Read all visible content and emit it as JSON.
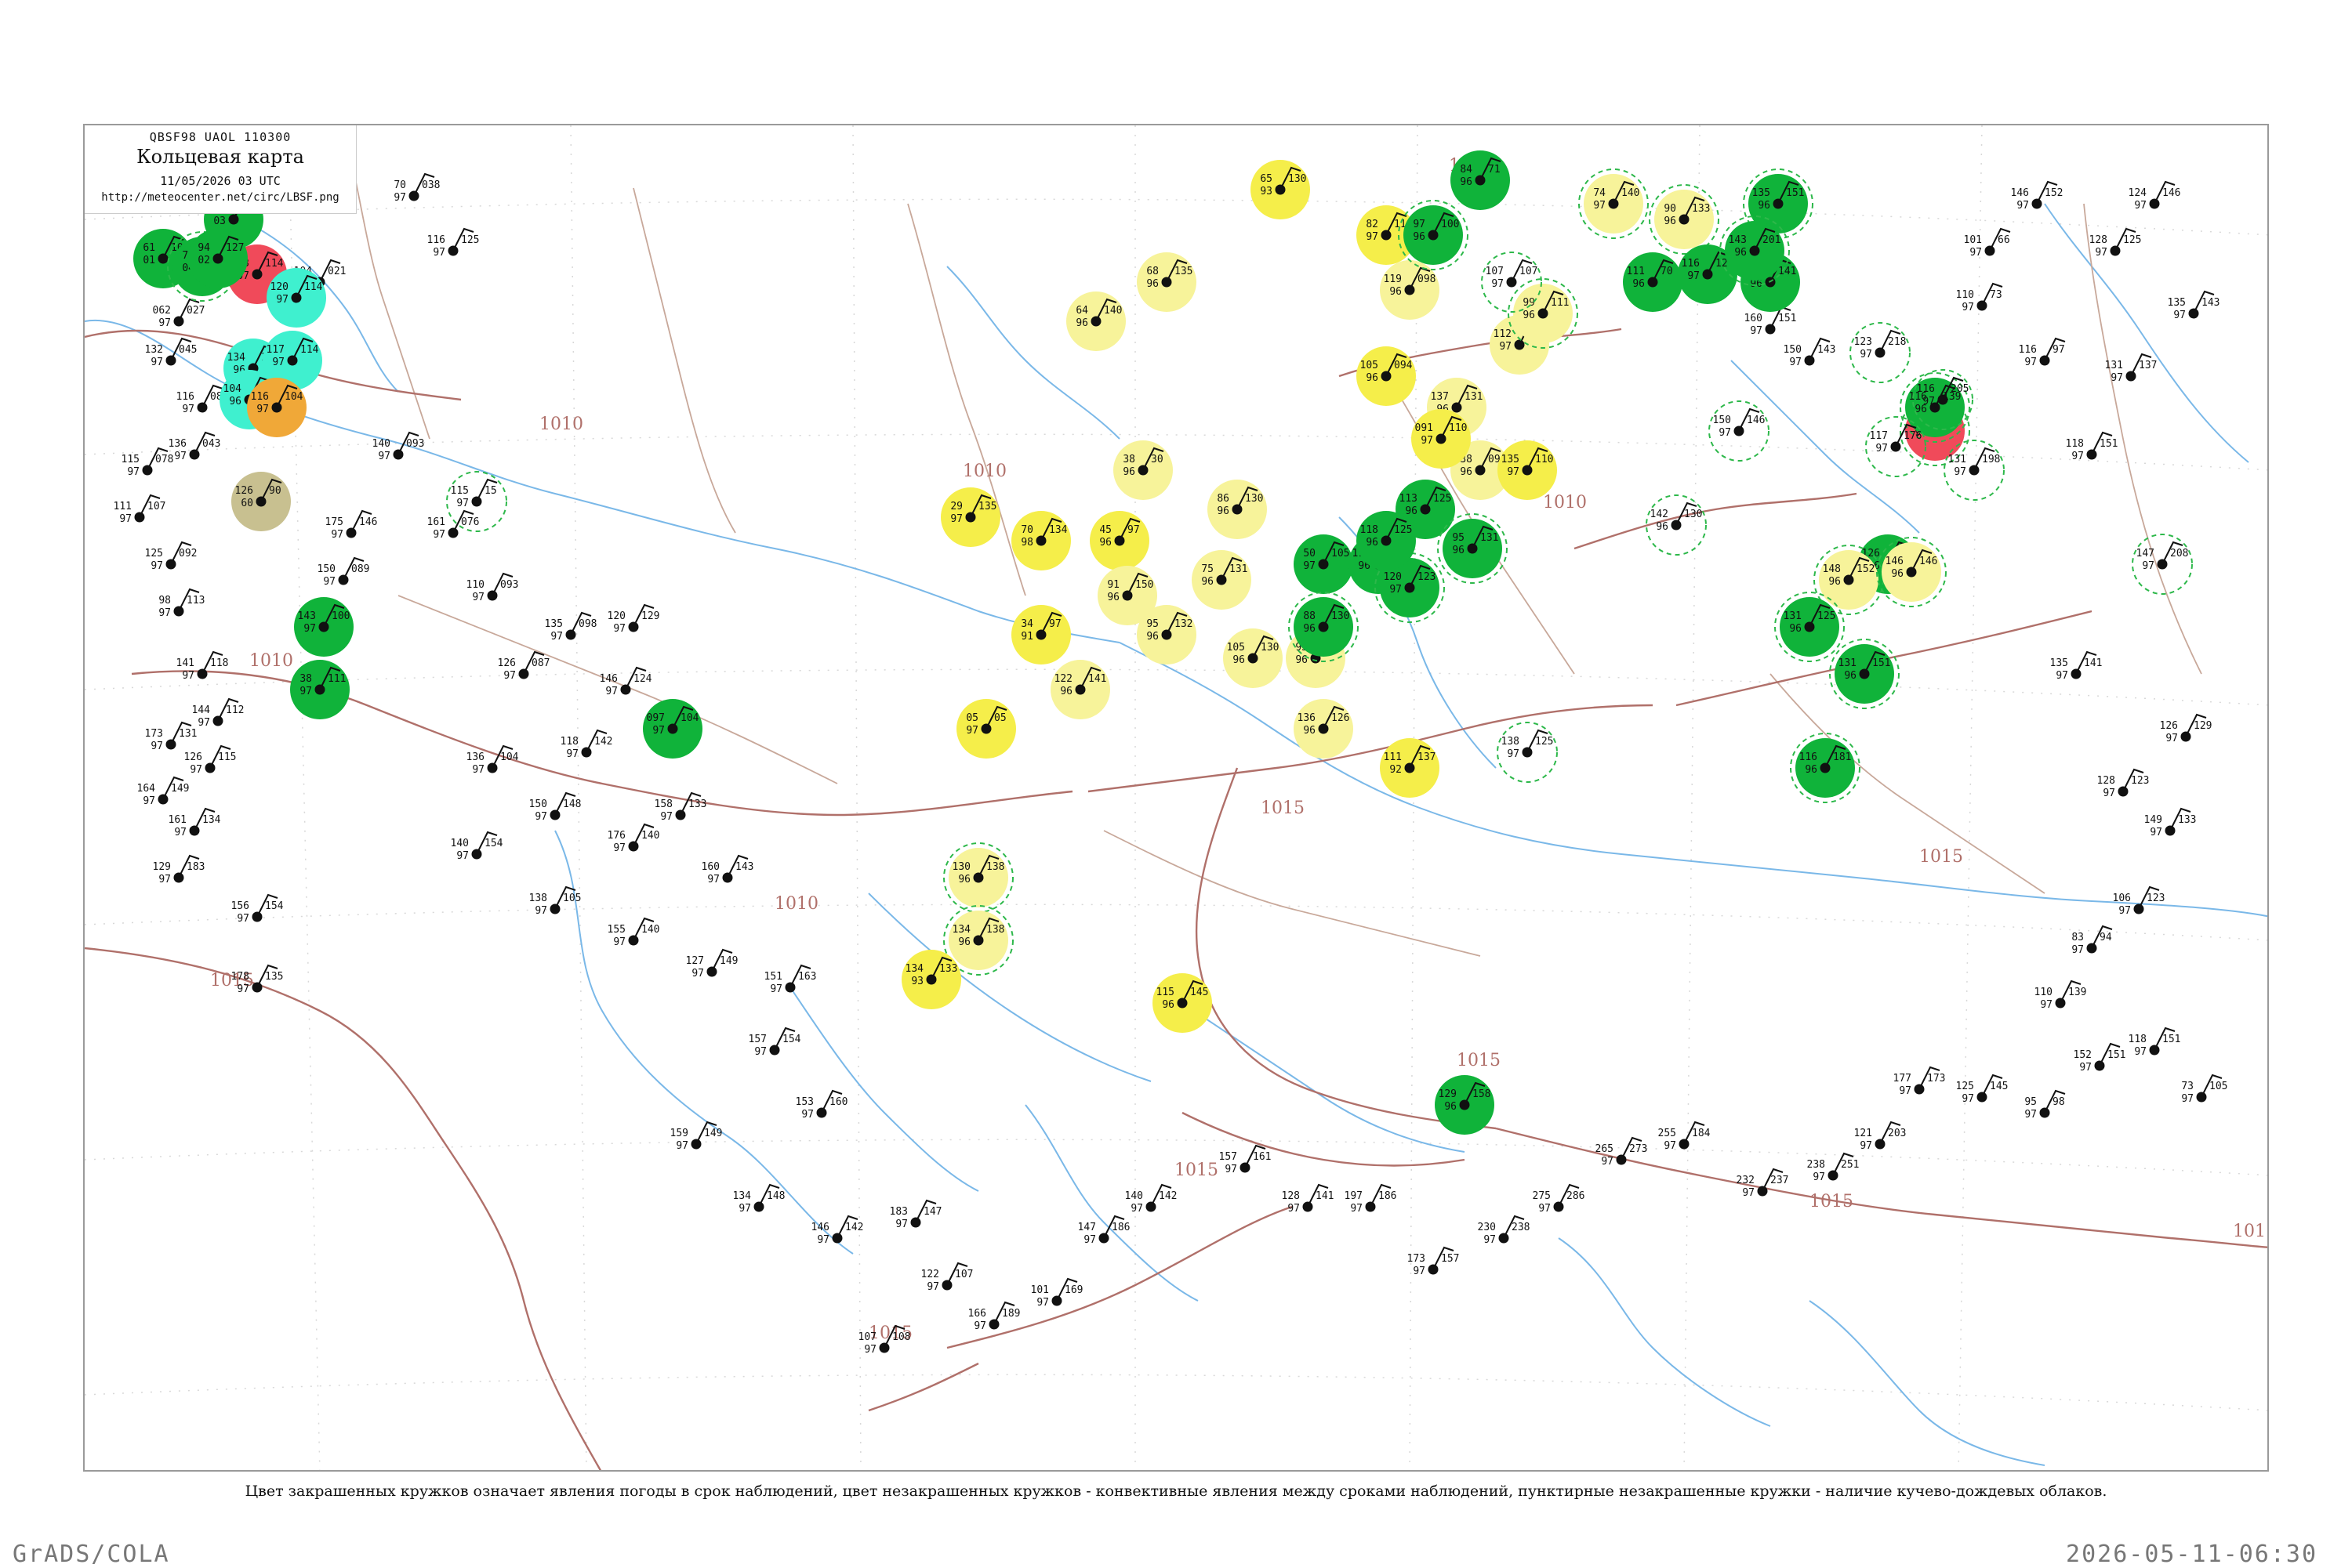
{
  "header": {
    "code": "QBSF98  UAOL  110300",
    "title": "Кольцевая карта",
    "time": "11/05/2026 03 UTC",
    "url": "http://meteocenter.net/circ/LBSF.png"
  },
  "legend": "Цвет закрашенных кружков означает явления погоды в срок наблюдений, цвет незакрашенных кружков - конвективные явления между сроками наблюдений, пунктирные незакрашенные кружки - наличие кучево-дождевых облаков.",
  "footer": {
    "left": "GrADS/COLA",
    "right": "2026-05-11-06:30"
  },
  "isobars": [
    {
      "label": "1005"
    },
    {
      "label": "1010"
    },
    {
      "label": "1015"
    },
    {
      "label": "1010"
    },
    {
      "label": "1015"
    },
    {
      "label": "1015"
    },
    {
      "label": "1010"
    },
    {
      "label": "1015"
    },
    {
      "label": "1015"
    },
    {
      "label": "101"
    },
    {
      "label": "1010"
    },
    {
      "label": "1015"
    },
    {
      "label": "1015"
    },
    {
      "label": "1010"
    },
    {
      "label": "1010"
    }
  ],
  "colors": {
    "green": "#10b33a",
    "yellow": "#f5ee4a",
    "light_yellow": "#f7f39a",
    "cyan": "#3ff0cf",
    "orange": "#f0a838",
    "red": "#f04a5a",
    "olive": "#c8c090",
    "isobar": "#b0706a",
    "coast": "#7ab8e8",
    "border": "#c8a89a"
  },
  "stations": [
    {
      "kind": "filled",
      "color": "green",
      "cb": false,
      "t": "61",
      "td": "01",
      "p": "107"
    },
    {
      "kind": "filled",
      "color": "green",
      "cb": true,
      "t": "71",
      "td": "04",
      "p": "103"
    },
    {
      "kind": "filled",
      "color": "green",
      "cb": false,
      "t": "79",
      "td": "03",
      "p": "121"
    },
    {
      "kind": "filled",
      "color": "red",
      "cb": false,
      "t": "153",
      "td": "07",
      "p": "114"
    },
    {
      "kind": "filled",
      "color": "green",
      "cb": false,
      "t": "94",
      "td": "02",
      "p": "127"
    },
    {
      "kind": "filled",
      "color": "cyan",
      "cb": false,
      "t": "120",
      "td": "97",
      "p": "114"
    },
    {
      "kind": "filled",
      "color": "cyan",
      "cb": false,
      "t": "134",
      "td": "96",
      "p": "100"
    },
    {
      "kind": "filled",
      "color": "cyan",
      "cb": false,
      "t": "117",
      "td": "97",
      "p": "114"
    },
    {
      "kind": "filled",
      "color": "cyan",
      "cb": false,
      "t": "104",
      "td": "96",
      "p": "114"
    },
    {
      "kind": "filled",
      "color": "orange",
      "cb": false,
      "t": "116",
      "td": "97",
      "p": "104"
    },
    {
      "kind": "filled",
      "color": "olive",
      "cb": false,
      "t": "126",
      "td": "60",
      "p": "90"
    },
    {
      "kind": "filled",
      "color": "green",
      "cb": false,
      "t": "143",
      "td": "97",
      "p": "100"
    },
    {
      "kind": "filled",
      "color": "green",
      "cb": false,
      "t": "38",
      "td": "97",
      "p": "111"
    },
    {
      "kind": "filled",
      "color": "green",
      "cb": false,
      "t": "097",
      "td": "97",
      "p": "104"
    },
    {
      "kind": "filled",
      "color": "yellow",
      "cb": false,
      "t": "65",
      "td": "93",
      "p": "130"
    },
    {
      "kind": "filled",
      "color": "light_yellow",
      "cb": false,
      "t": "68",
      "td": "96",
      "p": "135"
    },
    {
      "kind": "filled",
      "color": "light_yellow",
      "cb": false,
      "t": "64",
      "td": "96",
      "p": "140"
    },
    {
      "kind": "filled",
      "color": "light_yellow",
      "cb": false,
      "t": "38",
      "td": "96",
      "p": "30"
    },
    {
      "kind": "filled",
      "color": "yellow",
      "cb": false,
      "t": "29",
      "td": "97",
      "p": "135"
    },
    {
      "kind": "filled",
      "color": "yellow",
      "cb": false,
      "t": "70",
      "td": "98",
      "p": "134"
    },
    {
      "kind": "filled",
      "color": "yellow",
      "cb": false,
      "t": "45",
      "td": "96",
      "p": "97"
    },
    {
      "kind": "filled",
      "color": "light_yellow",
      "cb": false,
      "t": "91",
      "td": "96",
      "p": "150"
    },
    {
      "kind": "filled",
      "color": "yellow",
      "cb": false,
      "t": "34",
      "td": "91",
      "p": "97"
    },
    {
      "kind": "filled",
      "color": "light_yellow",
      "cb": false,
      "t": "95",
      "td": "96",
      "p": "132"
    },
    {
      "kind": "filled",
      "color": "light_yellow",
      "cb": false,
      "t": "122",
      "td": "96",
      "p": "141"
    },
    {
      "kind": "filled",
      "color": "yellow",
      "cb": false,
      "t": "05",
      "td": "97",
      "p": "05"
    },
    {
      "kind": "filled",
      "color": "light_yellow",
      "cb": false,
      "t": "86",
      "td": "96",
      "p": "130"
    },
    {
      "kind": "filled",
      "color": "light_yellow",
      "cb": false,
      "t": "75",
      "td": "96",
      "p": "131"
    },
    {
      "kind": "filled",
      "color": "light_yellow",
      "cb": false,
      "t": "105",
      "td": "96",
      "p": "130"
    },
    {
      "kind": "filled",
      "color": "light_yellow",
      "cb": false,
      "t": "93",
      "td": "96",
      "p": "114"
    },
    {
      "kind": "filled",
      "color": "light_yellow",
      "cb": false,
      "t": "136",
      "td": "96",
      "p": "126"
    },
    {
      "kind": "filled",
      "color": "yellow",
      "cb": false,
      "t": "111",
      "td": "92",
      "p": "137"
    },
    {
      "kind": "filled",
      "color": "yellow",
      "cb": false,
      "t": "82",
      "td": "97",
      "p": "116"
    },
    {
      "kind": "filled",
      "color": "yellow",
      "cb": false,
      "t": "105",
      "td": "96",
      "p": "094"
    },
    {
      "kind": "filled",
      "color": "green",
      "cb": false,
      "t": "50",
      "td": "97",
      "p": "105"
    },
    {
      "kind": "filled",
      "color": "green",
      "cb": false,
      "t": "116",
      "td": "96",
      "p": "141"
    },
    {
      "kind": "filled",
      "color": "green",
      "cb": true,
      "t": "88",
      "td": "96",
      "p": "130"
    },
    {
      "kind": "filled",
      "color": "green",
      "cb": true,
      "t": "120",
      "td": "97",
      "p": "123"
    },
    {
      "kind": "filled",
      "color": "green",
      "cb": false,
      "t": "113",
      "td": "96",
      "p": "125"
    },
    {
      "kind": "filled",
      "color": "green",
      "cb": false,
      "t": "118",
      "td": "96",
      "p": "125"
    },
    {
      "kind": "filled",
      "color": "green",
      "cb": true,
      "t": "95",
      "td": "96",
      "p": "131"
    },
    {
      "kind": "filled",
      "color": "light_yellow",
      "cb": false,
      "t": "119",
      "td": "96",
      "p": "098"
    },
    {
      "kind": "filled",
      "color": "light_yellow",
      "cb": false,
      "t": "137",
      "td": "96",
      "p": "131"
    },
    {
      "kind": "filled",
      "color": "light_yellow",
      "cb": false,
      "t": "138",
      "td": "96",
      "p": "090"
    },
    {
      "kind": "filled",
      "color": "yellow",
      "cb": false,
      "t": "091",
      "td": "97",
      "p": "110"
    },
    {
      "kind": "filled",
      "color": "yellow",
      "cb": false,
      "t": "135",
      "td": "97",
      "p": "110"
    },
    {
      "kind": "filled",
      "color": "light_yellow",
      "cb": false,
      "t": "112",
      "td": "97",
      "p": "107"
    },
    {
      "kind": "filled",
      "color": "green",
      "cb": false,
      "t": "84",
      "td": "96",
      "p": "71"
    },
    {
      "kind": "filled",
      "color": "green",
      "cb": true,
      "t": "97",
      "td": "96",
      "p": "100"
    },
    {
      "kind": "filled",
      "color": "light_yellow",
      "cb": true,
      "t": "74",
      "td": "97",
      "p": "140"
    },
    {
      "kind": "filled",
      "color": "light_yellow",
      "cb": true,
      "t": "90",
      "td": "96",
      "p": "133"
    },
    {
      "kind": "filled",
      "color": "light_yellow",
      "cb": true,
      "t": "99",
      "td": "96",
      "p": "111"
    },
    {
      "kind": "filled",
      "color": "green",
      "cb": false,
      "t": "116",
      "td": "97",
      "p": "120"
    },
    {
      "kind": "filled",
      "color": "green",
      "cb": false,
      "t": "111",
      "td": "96",
      "p": "70"
    },
    {
      "kind": "filled",
      "color": "green",
      "cb": false,
      "t": "102",
      "td": "96",
      "p": "141"
    },
    {
      "kind": "filled",
      "color": "green",
      "cb": true,
      "t": "135",
      "td": "96",
      "p": "151"
    },
    {
      "kind": "filled",
      "color": "green",
      "cb": true,
      "t": "143",
      "td": "96",
      "p": "201"
    },
    {
      "kind": "filled",
      "color": "red",
      "cb": true,
      "t": "140",
      "td": "97",
      "p": "127"
    },
    {
      "kind": "filled",
      "color": "green",
      "cb": true,
      "t": "116",
      "td": "96",
      "p": "139"
    },
    {
      "kind": "filled",
      "color": "green",
      "cb": false,
      "t": "126",
      "td": "96",
      "p": "140"
    },
    {
      "kind": "filled",
      "color": "light_yellow",
      "cb": true,
      "t": "148",
      "td": "96",
      "p": "152"
    },
    {
      "kind": "filled",
      "color": "light_yellow",
      "cb": true,
      "t": "146",
      "td": "96",
      "p": "146"
    },
    {
      "kind": "filled",
      "color": "green",
      "cb": true,
      "t": "131",
      "td": "96",
      "p": "125"
    },
    {
      "kind": "filled",
      "color": "green",
      "cb": true,
      "t": "131",
      "td": "96",
      "p": "151"
    },
    {
      "kind": "filled",
      "color": "green",
      "cb": true,
      "t": "116",
      "td": "96",
      "p": "181"
    },
    {
      "kind": "filled",
      "color": "light_yellow",
      "cb": true,
      "t": "130",
      "td": "96",
      "p": "138"
    },
    {
      "kind": "filled",
      "color": "light_yellow",
      "cb": true,
      "t": "134",
      "td": "96",
      "p": "138"
    },
    {
      "kind": "filled",
      "color": "yellow",
      "cb": false,
      "t": "134",
      "td": "93",
      "p": "133"
    },
    {
      "kind": "filled",
      "color": "yellow",
      "cb": false,
      "t": "115",
      "td": "96",
      "p": "145"
    },
    {
      "kind": "filled",
      "color": "green",
      "cb": false,
      "t": "129",
      "td": "96",
      "p": "158"
    },
    {
      "kind": "open",
      "cb": true,
      "t": "115",
      "td": "97",
      "p": "15"
    },
    {
      "kind": "open",
      "cb": true,
      "t": "107",
      "td": "97",
      "p": "107"
    },
    {
      "kind": "open",
      "cb": true,
      "t": "138",
      "td": "97",
      "p": "125"
    },
    {
      "kind": "open",
      "cb": true,
      "t": "147",
      "td": "97",
      "p": "208"
    },
    {
      "kind": "open",
      "cb": true,
      "t": "142",
      "td": "96",
      "p": "130"
    },
    {
      "kind": "open",
      "cb": true,
      "t": "150",
      "td": "97",
      "p": "146"
    },
    {
      "kind": "open",
      "cb": true,
      "t": "117",
      "td": "97",
      "p": "176"
    },
    {
      "kind": "open",
      "cb": true,
      "t": "131",
      "td": "97",
      "p": "198"
    },
    {
      "kind": "open",
      "cb": true,
      "t": "123",
      "td": "97",
      "p": "218"
    },
    {
      "kind": "open",
      "cb": true,
      "t": "116",
      "td": "97",
      "p": "205"
    }
  ],
  "plain_stations": [
    {
      "t": "70",
      "td": "97",
      "p": "038"
    },
    {
      "t": "116",
      "td": "97",
      "p": "125"
    },
    {
      "t": "104",
      "td": "97",
      "p": "021"
    },
    {
      "t": "062",
      "td": "97",
      "p": "027"
    },
    {
      "t": "132",
      "td": "97",
      "p": "045"
    },
    {
      "t": "116",
      "td": "97",
      "p": "087"
    },
    {
      "t": "136",
      "td": "97",
      "p": "043"
    },
    {
      "t": "115",
      "td": "97",
      "p": "078"
    },
    {
      "t": "111",
      "td": "97",
      "p": "107"
    },
    {
      "t": "125",
      "td": "97",
      "p": "092"
    },
    {
      "t": "98",
      "td": "97",
      "p": "113"
    },
    {
      "t": "141",
      "td": "97",
      "p": "118"
    },
    {
      "t": "144",
      "td": "97",
      "p": "112"
    },
    {
      "t": "173",
      "td": "97",
      "p": "131"
    },
    {
      "t": "164",
      "td": "97",
      "p": "149"
    },
    {
      "t": "126",
      "td": "97",
      "p": "115"
    },
    {
      "t": "161",
      "td": "97",
      "p": "134"
    },
    {
      "t": "129",
      "td": "97",
      "p": "183"
    },
    {
      "t": "156",
      "td": "97",
      "p": "154"
    },
    {
      "t": "178",
      "td": "97",
      "p": "135"
    },
    {
      "t": "175",
      "td": "97",
      "p": "146"
    },
    {
      "t": "150",
      "td": "97",
      "p": "089"
    },
    {
      "t": "140",
      "td": "97",
      "p": "093"
    },
    {
      "t": "161",
      "td": "97",
      "p": "076"
    },
    {
      "t": "110",
      "td": "97",
      "p": "093"
    },
    {
      "t": "126",
      "td": "97",
      "p": "087"
    },
    {
      "t": "135",
      "td": "97",
      "p": "098"
    },
    {
      "t": "120",
      "td": "97",
      "p": "129"
    },
    {
      "t": "146",
      "td": "97",
      "p": "124"
    },
    {
      "t": "118",
      "td": "97",
      "p": "142"
    },
    {
      "t": "136",
      "td": "97",
      "p": "104"
    },
    {
      "t": "150",
      "td": "97",
      "p": "148"
    },
    {
      "t": "140",
      "td": "97",
      "p": "154"
    },
    {
      "t": "138",
      "td": "97",
      "p": "105"
    },
    {
      "t": "176",
      "td": "97",
      "p": "140"
    },
    {
      "t": "158",
      "td": "97",
      "p": "133"
    },
    {
      "t": "160",
      "td": "97",
      "p": "143"
    },
    {
      "t": "155",
      "td": "97",
      "p": "140"
    },
    {
      "t": "127",
      "td": "97",
      "p": "149"
    },
    {
      "t": "151",
      "td": "97",
      "p": "163"
    },
    {
      "t": "157",
      "td": "97",
      "p": "154"
    },
    {
      "t": "153",
      "td": "97",
      "p": "160"
    },
    {
      "t": "159",
      "td": "97",
      "p": "149"
    },
    {
      "t": "134",
      "td": "97",
      "p": "148"
    },
    {
      "t": "146",
      "td": "97",
      "p": "142"
    },
    {
      "t": "183",
      "td": "97",
      "p": "147"
    },
    {
      "t": "122",
      "td": "97",
      "p": "107"
    },
    {
      "t": "107",
      "td": "97",
      "p": "108"
    },
    {
      "t": "166",
      "td": "97",
      "p": "189"
    },
    {
      "t": "101",
      "td": "97",
      "p": "169"
    },
    {
      "t": "147",
      "td": "97",
      "p": "186"
    },
    {
      "t": "140",
      "td": "97",
      "p": "142"
    },
    {
      "t": "157",
      "td": "97",
      "p": "161"
    },
    {
      "t": "128",
      "td": "97",
      "p": "141"
    },
    {
      "t": "197",
      "td": "97",
      "p": "186"
    },
    {
      "t": "173",
      "td": "97",
      "p": "157"
    },
    {
      "t": "230",
      "td": "97",
      "p": "238"
    },
    {
      "t": "275",
      "td": "97",
      "p": "286"
    },
    {
      "t": "265",
      "td": "97",
      "p": "273"
    },
    {
      "t": "255",
      "td": "97",
      "p": "184"
    },
    {
      "t": "232",
      "td": "97",
      "p": "237"
    },
    {
      "t": "238",
      "td": "97",
      "p": "251"
    },
    {
      "t": "121",
      "td": "97",
      "p": "203"
    },
    {
      "t": "177",
      "td": "97",
      "p": "173"
    },
    {
      "t": "125",
      "td": "97",
      "p": "145"
    },
    {
      "t": "95",
      "td": "97",
      "p": "98"
    },
    {
      "t": "152",
      "td": "97",
      "p": "151"
    },
    {
      "t": "118",
      "td": "97",
      "p": "151"
    },
    {
      "t": "73",
      "td": "97",
      "p": "105"
    },
    {
      "t": "110",
      "td": "97",
      "p": "139"
    },
    {
      "t": "83",
      "td": "97",
      "p": "94"
    },
    {
      "t": "106",
      "td": "97",
      "p": "123"
    },
    {
      "t": "149",
      "td": "97",
      "p": "133"
    },
    {
      "t": "128",
      "td": "97",
      "p": "123"
    },
    {
      "t": "126",
      "td": "97",
      "p": "129"
    },
    {
      "t": "135",
      "td": "97",
      "p": "141"
    },
    {
      "t": "131",
      "td": "97",
      "p": "137"
    },
    {
      "t": "135",
      "td": "97",
      "p": "143"
    },
    {
      "t": "128",
      "td": "97",
      "p": "125"
    },
    {
      "t": "124",
      "td": "97",
      "p": "146"
    },
    {
      "t": "146",
      "td": "97",
      "p": "152"
    },
    {
      "t": "101",
      "td": "97",
      "p": "66"
    },
    {
      "t": "110",
      "td": "97",
      "p": "73"
    },
    {
      "t": "116",
      "td": "97",
      "p": "97"
    },
    {
      "t": "118",
      "td": "97",
      "p": "151"
    },
    {
      "t": "150",
      "td": "97",
      "p": "143"
    },
    {
      "t": "160",
      "td": "97",
      "p": "151"
    }
  ]
}
